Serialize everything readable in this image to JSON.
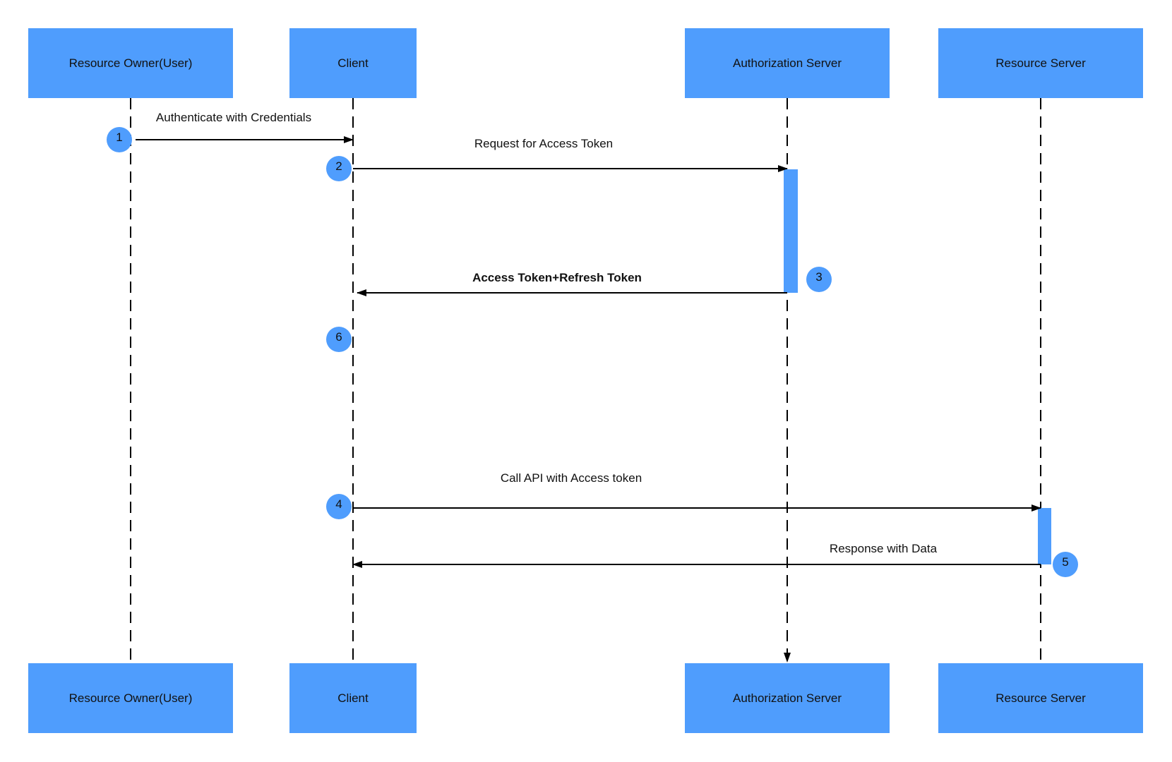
{
  "colors": {
    "participant_fill": "#4f9dfd",
    "line": "#000000"
  },
  "participants": [
    {
      "id": "owner",
      "label": "Resource Owner(User)"
    },
    {
      "id": "client",
      "label": "Client"
    },
    {
      "id": "auth",
      "label": "Authorization Server"
    },
    {
      "id": "resource",
      "label": "Resource Server"
    }
  ],
  "messages": [
    {
      "step": "1",
      "label": "Authenticate with Credentials",
      "from": "owner",
      "to": "client",
      "bold": false
    },
    {
      "step": "2",
      "label": "Request for Access Token",
      "from": "client",
      "to": "auth",
      "bold": false
    },
    {
      "step": "3",
      "label": "Access Token+Refresh Token",
      "from": "auth",
      "to": "client",
      "bold": true
    },
    {
      "step": "4",
      "label": "Call API with Access token",
      "from": "client",
      "to": "resource",
      "bold": false
    },
    {
      "step": "5",
      "label": "Response with Data",
      "from": "resource",
      "to": "client",
      "bold": false
    }
  ],
  "extra_steps": [
    {
      "step": "6",
      "on": "client"
    }
  ]
}
